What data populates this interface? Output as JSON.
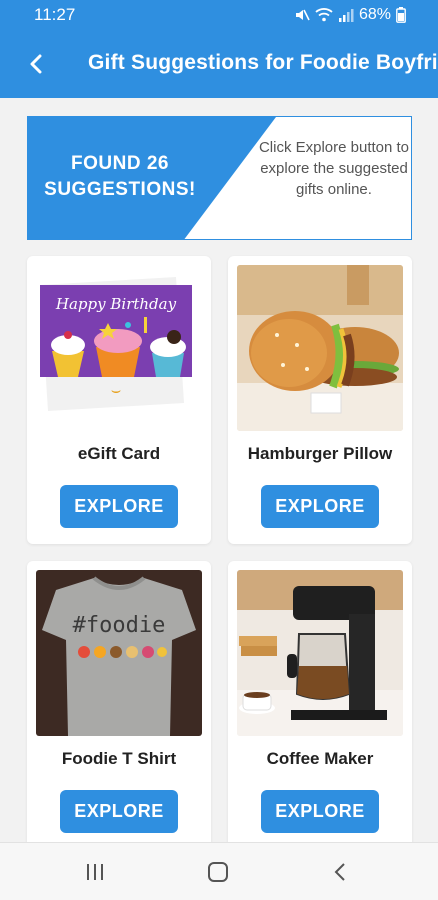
{
  "status_bar": {
    "time": "11:27",
    "battery": "68%"
  },
  "app_bar": {
    "title": "Gift Suggestions for Foodie Boyfriend"
  },
  "banner": {
    "count_line1": "FOUND 26",
    "count_line2": "SUGGESTIONS!",
    "hint": "Click Explore button to explore the suggested gifts online."
  },
  "colors": {
    "primary": "#2f8fe0",
    "background": "#f2f2f2"
  },
  "items": [
    {
      "name": "eGift Card",
      "button": "EXPLORE",
      "image": "birthday-egift-card-image"
    },
    {
      "name": "Hamburger Pillow",
      "button": "EXPLORE",
      "image": "hamburger-pillow-image"
    },
    {
      "name": "Foodie T Shirt",
      "button": "EXPLORE",
      "image": "foodie-tshirt-image"
    },
    {
      "name": "Coffee Maker",
      "button": "EXPLORE",
      "image": "coffee-maker-image"
    }
  ],
  "egift_image": {
    "text": "Happy Birthday"
  },
  "tshirt_image": {
    "text": "#foodie"
  },
  "nav": {
    "recents": "recents-icon",
    "home": "home-icon",
    "back": "back-icon"
  }
}
